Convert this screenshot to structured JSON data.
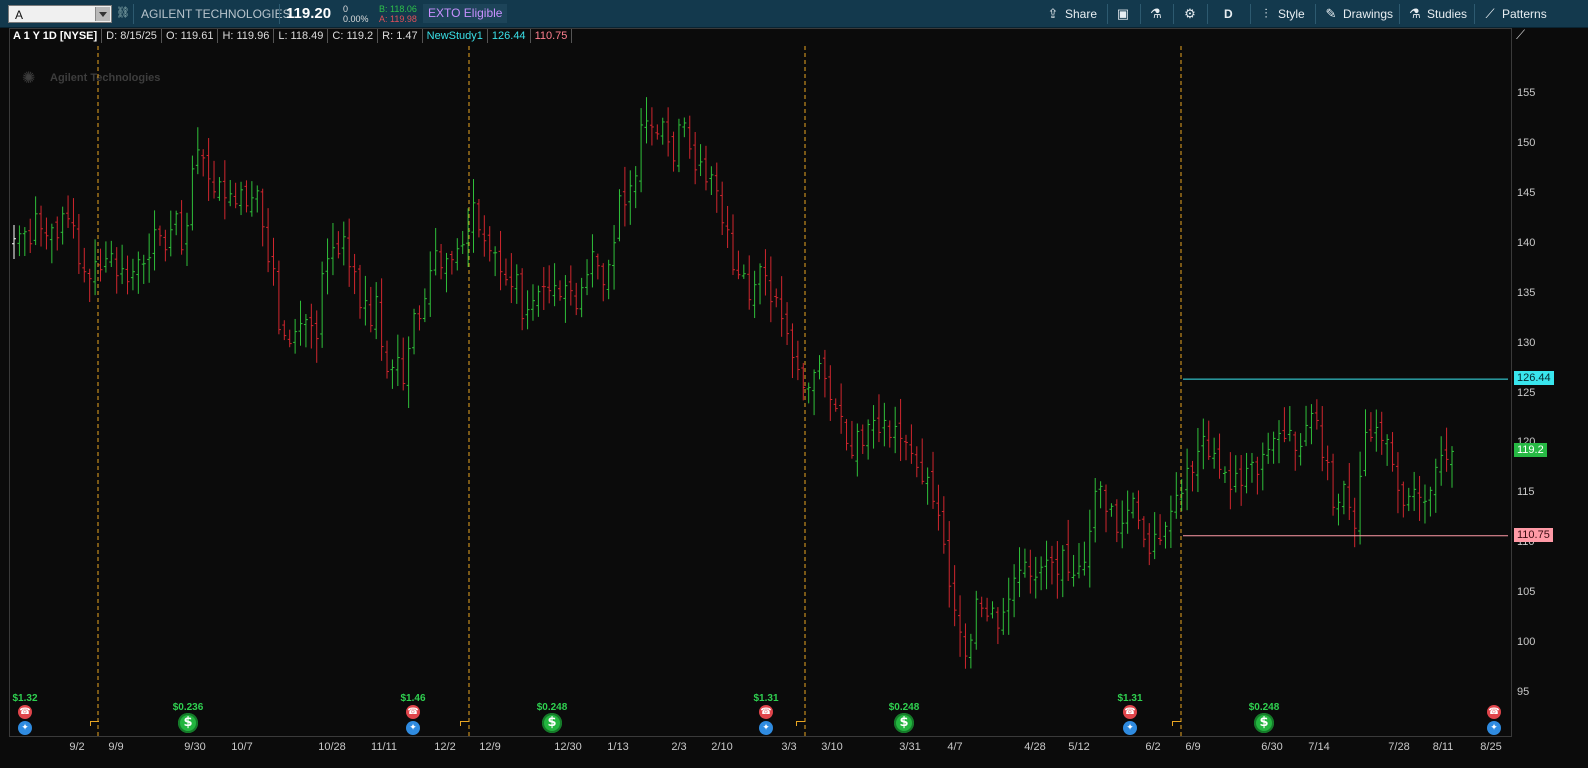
{
  "toolbar": {
    "symbol": "A",
    "company": "AGILENT TECHNOLOGIES",
    "last": "119.20",
    "net_change": "0",
    "pct_change": "0.00%",
    "bid": "B: 118.06",
    "ask": "A: 119.98",
    "exto": "EXTO Eligible",
    "buttons": {
      "share": "Share",
      "period": "D",
      "style": "Style",
      "drawings": "Drawings",
      "studies": "Studies",
      "patterns": "Patterns"
    }
  },
  "info_bar": {
    "symbol": "A 1 Y 1D [NYSE]",
    "date": "D: 8/15/25",
    "open": "O: 119.61",
    "high": "H: 119.96",
    "low": "L: 118.49",
    "close": "C: 119.2",
    "range": "R: 1.47",
    "study": "NewStudy1",
    "study_hi": "126.44",
    "study_lo": "110.75"
  },
  "watermark": "Agilent Technologies",
  "price_axis": {
    "ticks": [
      "155",
      "150",
      "145",
      "140",
      "135",
      "130",
      "125",
      "120",
      "115",
      "110",
      "105",
      "100",
      "95"
    ],
    "badge_hi": "126.44",
    "badge_last": "119.2",
    "badge_lo": "110.75"
  },
  "date_axis": [
    "9/2",
    "9/9",
    "9/30",
    "10/7",
    "10/28",
    "11/11",
    "12/2",
    "12/9",
    "12/30",
    "1/13",
    "2/3",
    "2/10",
    "3/3",
    "3/10",
    "3/31",
    "4/7",
    "4/28",
    "5/12",
    "6/2",
    "6/9",
    "6/30",
    "7/14",
    "7/28",
    "8/11",
    "8/25"
  ],
  "events": {
    "earnings": [
      "$1.32",
      "$1.46",
      "$1.31",
      "$1.31"
    ],
    "dividends": [
      "$0.236",
      "$0.248",
      "$0.248",
      "$0.248"
    ]
  },
  "colors": {
    "up": "#2fbf3a",
    "down": "#d0262e",
    "study_hi": "#39e6ee",
    "study_lo": "#ff9aa6",
    "split": "#e8a522"
  },
  "chart_data": {
    "type": "ohlc",
    "ylim": [
      92,
      158
    ],
    "study_lines": {
      "high": 126.44,
      "low": 110.75
    },
    "closes": [
      140.5,
      141,
      141.2,
      140,
      143,
      141.5,
      140.8,
      141.6,
      140.6,
      143,
      142.5,
      141.8,
      138,
      137.2,
      136.5,
      138.2,
      137.4,
      138.5,
      139,
      136.8,
      137.5,
      136.2,
      137.2,
      138.4,
      138,
      138.6,
      141.4,
      140.8,
      139.4,
      141.4,
      143,
      139.4,
      141.8,
      147.5,
      149.4,
      148.6,
      146.5,
      145.2,
      146.2,
      144.6,
      145,
      144,
      145.4,
      143.8,
      144.6,
      145.3,
      141.7,
      138.2,
      137.5,
      131.4,
      130.8,
      130,
      131.2,
      132,
      132.4,
      131.8,
      130.5,
      137,
      138.5,
      139.6,
      139,
      140.7,
      137.7,
      137.2,
      133.6,
      134.3,
      131.8,
      134.7,
      129.7,
      127.2,
      127.6,
      128.6,
      126,
      129.5,
      133,
      132.5,
      134.5,
      137.3,
      139.3,
      137.6,
      138.5,
      138.4,
      139.5,
      139.9,
      141.3,
      144.1,
      141.4,
      140.3,
      139.3,
      139.1,
      137.2,
      136.4,
      135.7,
      136.9,
      132.5,
      133.4,
      134.3,
      135.2,
      135.7,
      135.3,
      135.8,
      134.7,
      135.8,
      135.3,
      133.5,
      135.6,
      136.9,
      139.2,
      137.8,
      135.9,
      137.9,
      140.1,
      144.8,
      143.9,
      145.8,
      146.8,
      151.9,
      152.3,
      151.7,
      151,
      152.2,
      150.2,
      148.3,
      151.9,
      152.1,
      149.5,
      147.4,
      148.2,
      146.2,
      146.9,
      145.3,
      142.1,
      141.4,
      137.4,
      136.9,
      137,
      134.4,
      135.9,
      137.7,
      136.8,
      134.2,
      134.6,
      132.5,
      131,
      128.6,
      127.4,
      125.6,
      125.6,
      127.1,
      128,
      126.5,
      124.4,
      123.5,
      122.7,
      120,
      118.8,
      121.2,
      119.8,
      121.9,
      122.3,
      121.1,
      122.3,
      120.6,
      121.7,
      120.5,
      120.1,
      119,
      117.6,
      116.2,
      116.6,
      114.2,
      112.8,
      109.9,
      105.7,
      103.3,
      101.1,
      98.7,
      100.3,
      104.4,
      103.5,
      102.7,
      103.5,
      101.5,
      103.1,
      104.4,
      106.5,
      107.3,
      108.1,
      106.7,
      106.6,
      107.6,
      108.3,
      108.1,
      106.9,
      109.3,
      107.1,
      106.8,
      107.7,
      108.1,
      111.2,
      115.2,
      115.7,
      113.2,
      113.7,
      111.1,
      112,
      113.3,
      114.5,
      112.3,
      110.4,
      109,
      110.9,
      110.3,
      111.7,
      113.2,
      114.8,
      115,
      117.5,
      117.1,
      119.2,
      120.7,
      118.7,
      119,
      117.4,
      117.1,
      115.4,
      117,
      115.8,
      117.5,
      118.1,
      116.9,
      118.9,
      119.4,
      120.5,
      121,
      120.5,
      121.3,
      119.3,
      119.7,
      121.8,
      123,
      122.3,
      118.6,
      118.1,
      113.6,
      114.1,
      115.9,
      113.6,
      111.5,
      116.7,
      121.1,
      120.6,
      121.6,
      120.3,
      120.4,
      117.9,
      115.3,
      113.8,
      114.7,
      115.4,
      114.6,
      114.2,
      115.3,
      117.6,
      118.8,
      118.4,
      119.2
    ]
  }
}
